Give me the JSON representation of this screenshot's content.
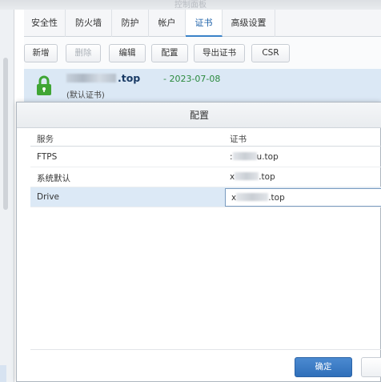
{
  "window": {
    "title": "控制面板"
  },
  "tabs": [
    {
      "label": "安全性"
    },
    {
      "label": "防火墙"
    },
    {
      "label": "防护"
    },
    {
      "label": "帐户"
    },
    {
      "label": "证书",
      "active": true
    },
    {
      "label": "高级设置"
    }
  ],
  "toolbar": {
    "add": "新增",
    "delete": "删除",
    "edit": "编辑",
    "configure": "配置",
    "export": "导出证书",
    "csr": "CSR"
  },
  "certificate": {
    "domain_suffix": ".top",
    "date": "- 2023-07-08",
    "note": "(默认证书)",
    "status_color": "#3fa535"
  },
  "dialog": {
    "title": "配置",
    "columns": {
      "service": "服务",
      "certificate": "证书"
    },
    "rows": [
      {
        "service": "FTPS",
        "cert_prefix": ":",
        "cert_suffix": "u.top"
      },
      {
        "service": "系统默认",
        "cert_prefix": "x",
        "cert_suffix": ".top"
      },
      {
        "service": "Drive",
        "cert_prefix": "x",
        "cert_suffix": ".top",
        "selected": true
      }
    ],
    "ok": "确定"
  },
  "colors": {
    "accent": "#3a82c8",
    "selection": "#dce9f6",
    "primary_button": "#3a7cc6"
  }
}
